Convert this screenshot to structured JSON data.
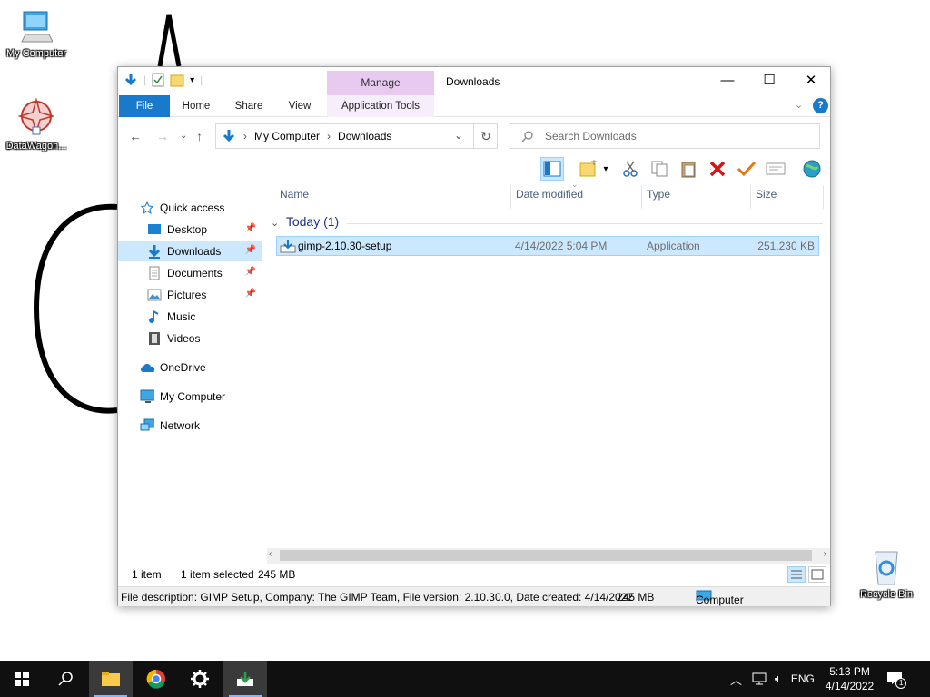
{
  "desktop": {
    "icons": [
      {
        "label": "My Computer"
      },
      {
        "label": "DataWagon..."
      },
      {
        "label": "Recycle Bin"
      }
    ]
  },
  "window": {
    "title": "Downloads",
    "manage_label": "Manage",
    "ribbon_tabs": [
      "File",
      "Home",
      "Share",
      "View",
      "Application Tools"
    ],
    "controls": {
      "minimize": "—",
      "maximize": "☐",
      "close": "✕"
    },
    "help": "?"
  },
  "address": {
    "breadcrumb": [
      "My Computer",
      "Downloads"
    ],
    "search_placeholder": "Search Downloads"
  },
  "nav": {
    "items": [
      {
        "label": "Quick access",
        "icon": "star-icon"
      },
      {
        "label": "Desktop",
        "icon": "desktop-folder-icon"
      },
      {
        "label": "Downloads",
        "icon": "download-arrow-icon"
      },
      {
        "label": "Documents",
        "icon": "document-icon"
      },
      {
        "label": "Pictures",
        "icon": "pictures-icon"
      },
      {
        "label": "Music",
        "icon": "music-note-icon"
      },
      {
        "label": "Videos",
        "icon": "film-icon"
      },
      {
        "label": "OneDrive",
        "icon": "cloud-icon"
      },
      {
        "label": "My Computer",
        "icon": "computer-icon"
      },
      {
        "label": "Network",
        "icon": "network-icon"
      }
    ]
  },
  "columns": [
    "Name",
    "Date modified",
    "Type",
    "Size"
  ],
  "group": {
    "label": "Today (1)"
  },
  "files": [
    {
      "name": "gimp-2.10.30-setup",
      "date": "4/14/2022 5:04 PM",
      "type": "Application",
      "size": "251,230 KB"
    }
  ],
  "status": {
    "count": "1 item",
    "selected": "1 item selected",
    "size": "245 MB"
  },
  "details": {
    "description": "File description: GIMP Setup, Company: The GIMP Team, File version: 2.10.30.0, Date created: 4/14/2022",
    "size": "245 MB",
    "location": "Computer"
  },
  "taskbar": {
    "time": "5:13 PM",
    "date": "4/14/2022",
    "language": "ENG",
    "notifications": "1"
  },
  "colors": {
    "file_tab": "#1979ca",
    "manage_tab": "#e8c9f0",
    "selection": "#cce8ff",
    "taskbar": "#101010"
  }
}
